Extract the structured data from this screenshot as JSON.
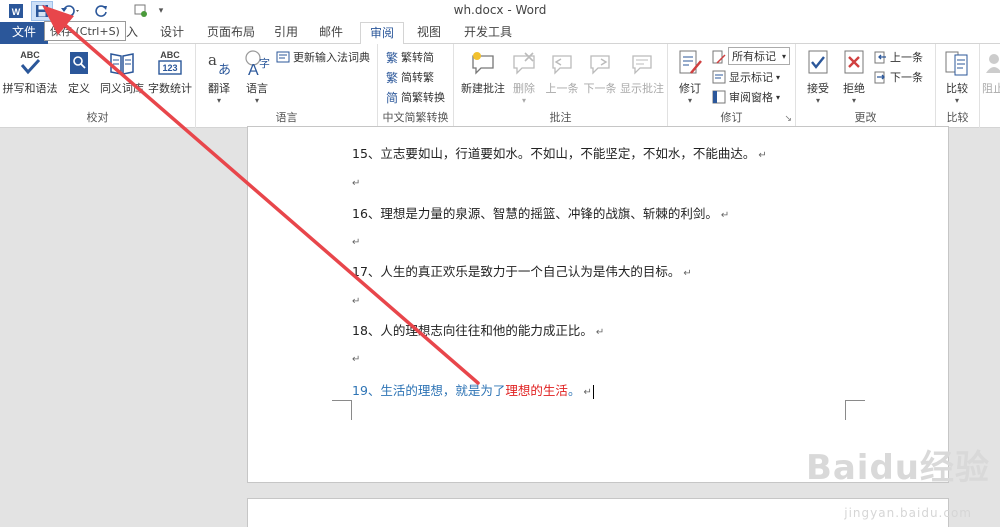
{
  "title_bar": {
    "doc_title": "wh.docx - Word",
    "tooltip": "保存 (Ctrl+S)"
  },
  "tabs": [
    {
      "label": "文件",
      "type": "file"
    },
    {
      "label": "插入",
      "type": "normal"
    },
    {
      "label": "设计",
      "type": "normal"
    },
    {
      "label": "页面布局",
      "type": "normal"
    },
    {
      "label": "引用",
      "type": "normal"
    },
    {
      "label": "邮件",
      "type": "normal"
    },
    {
      "label": "审阅",
      "type": "active"
    },
    {
      "label": "视图",
      "type": "normal"
    },
    {
      "label": "开发工具",
      "type": "normal"
    }
  ],
  "ribbon": {
    "proofing": {
      "label": "校对",
      "spelling": "拼写和语法",
      "define": "定义",
      "thesaurus": "同义词库",
      "wordcount": "字数统计"
    },
    "language": {
      "label": "语言",
      "translate": "翻译",
      "language": "语言",
      "update_ime": "更新输入法词典"
    },
    "chinese_conversion": {
      "label": "中文简繁转换",
      "to_simplified": "繁转简",
      "to_traditional": "简转繁",
      "convert": "简繁转换"
    },
    "comments": {
      "label": "批注",
      "new": "新建批注",
      "delete": "删除",
      "previous": "上一条",
      "next": "下一条",
      "show": "显示批注"
    },
    "tracking": {
      "label": "修订",
      "track": "修订",
      "markup_value": "所有标记",
      "show_markup": "显示标记",
      "pane": "审阅窗格"
    },
    "changes": {
      "label": "更改",
      "accept": "接受",
      "reject": "拒绝",
      "previous": "上一条",
      "next": "下一条"
    },
    "compare": {
      "label": "比较",
      "compare": "比较",
      "block": "阻止"
    }
  },
  "document": {
    "paragraphs": [
      {
        "text": "15、立志要如山，行道要如水。不如山，不能坚定，不如水，不能曲达。"
      },
      {
        "text": "16、理想是力量的泉源、智慧的摇篮、冲锋的战旗、斩棘的利剑。"
      },
      {
        "text": "17、人生的真正欢乐是致力于一个自己认为是伟大的目标。"
      },
      {
        "text": "18、人的理想志向往往和他的能力成正比。"
      }
    ],
    "last_paragraph": {
      "blue_text": "19、生活的理想，就是为了",
      "red_text": "理想的生活",
      "end": "。"
    },
    "paragraph_mark": "↵"
  },
  "watermark": {
    "brand": "Baidu经验",
    "url": "jingyan.baidu.com"
  },
  "colors": {
    "accent": "#2b579a",
    "arrow": "#e8464b",
    "blue_text": "#2e74b5",
    "red_text": "#e02020"
  }
}
